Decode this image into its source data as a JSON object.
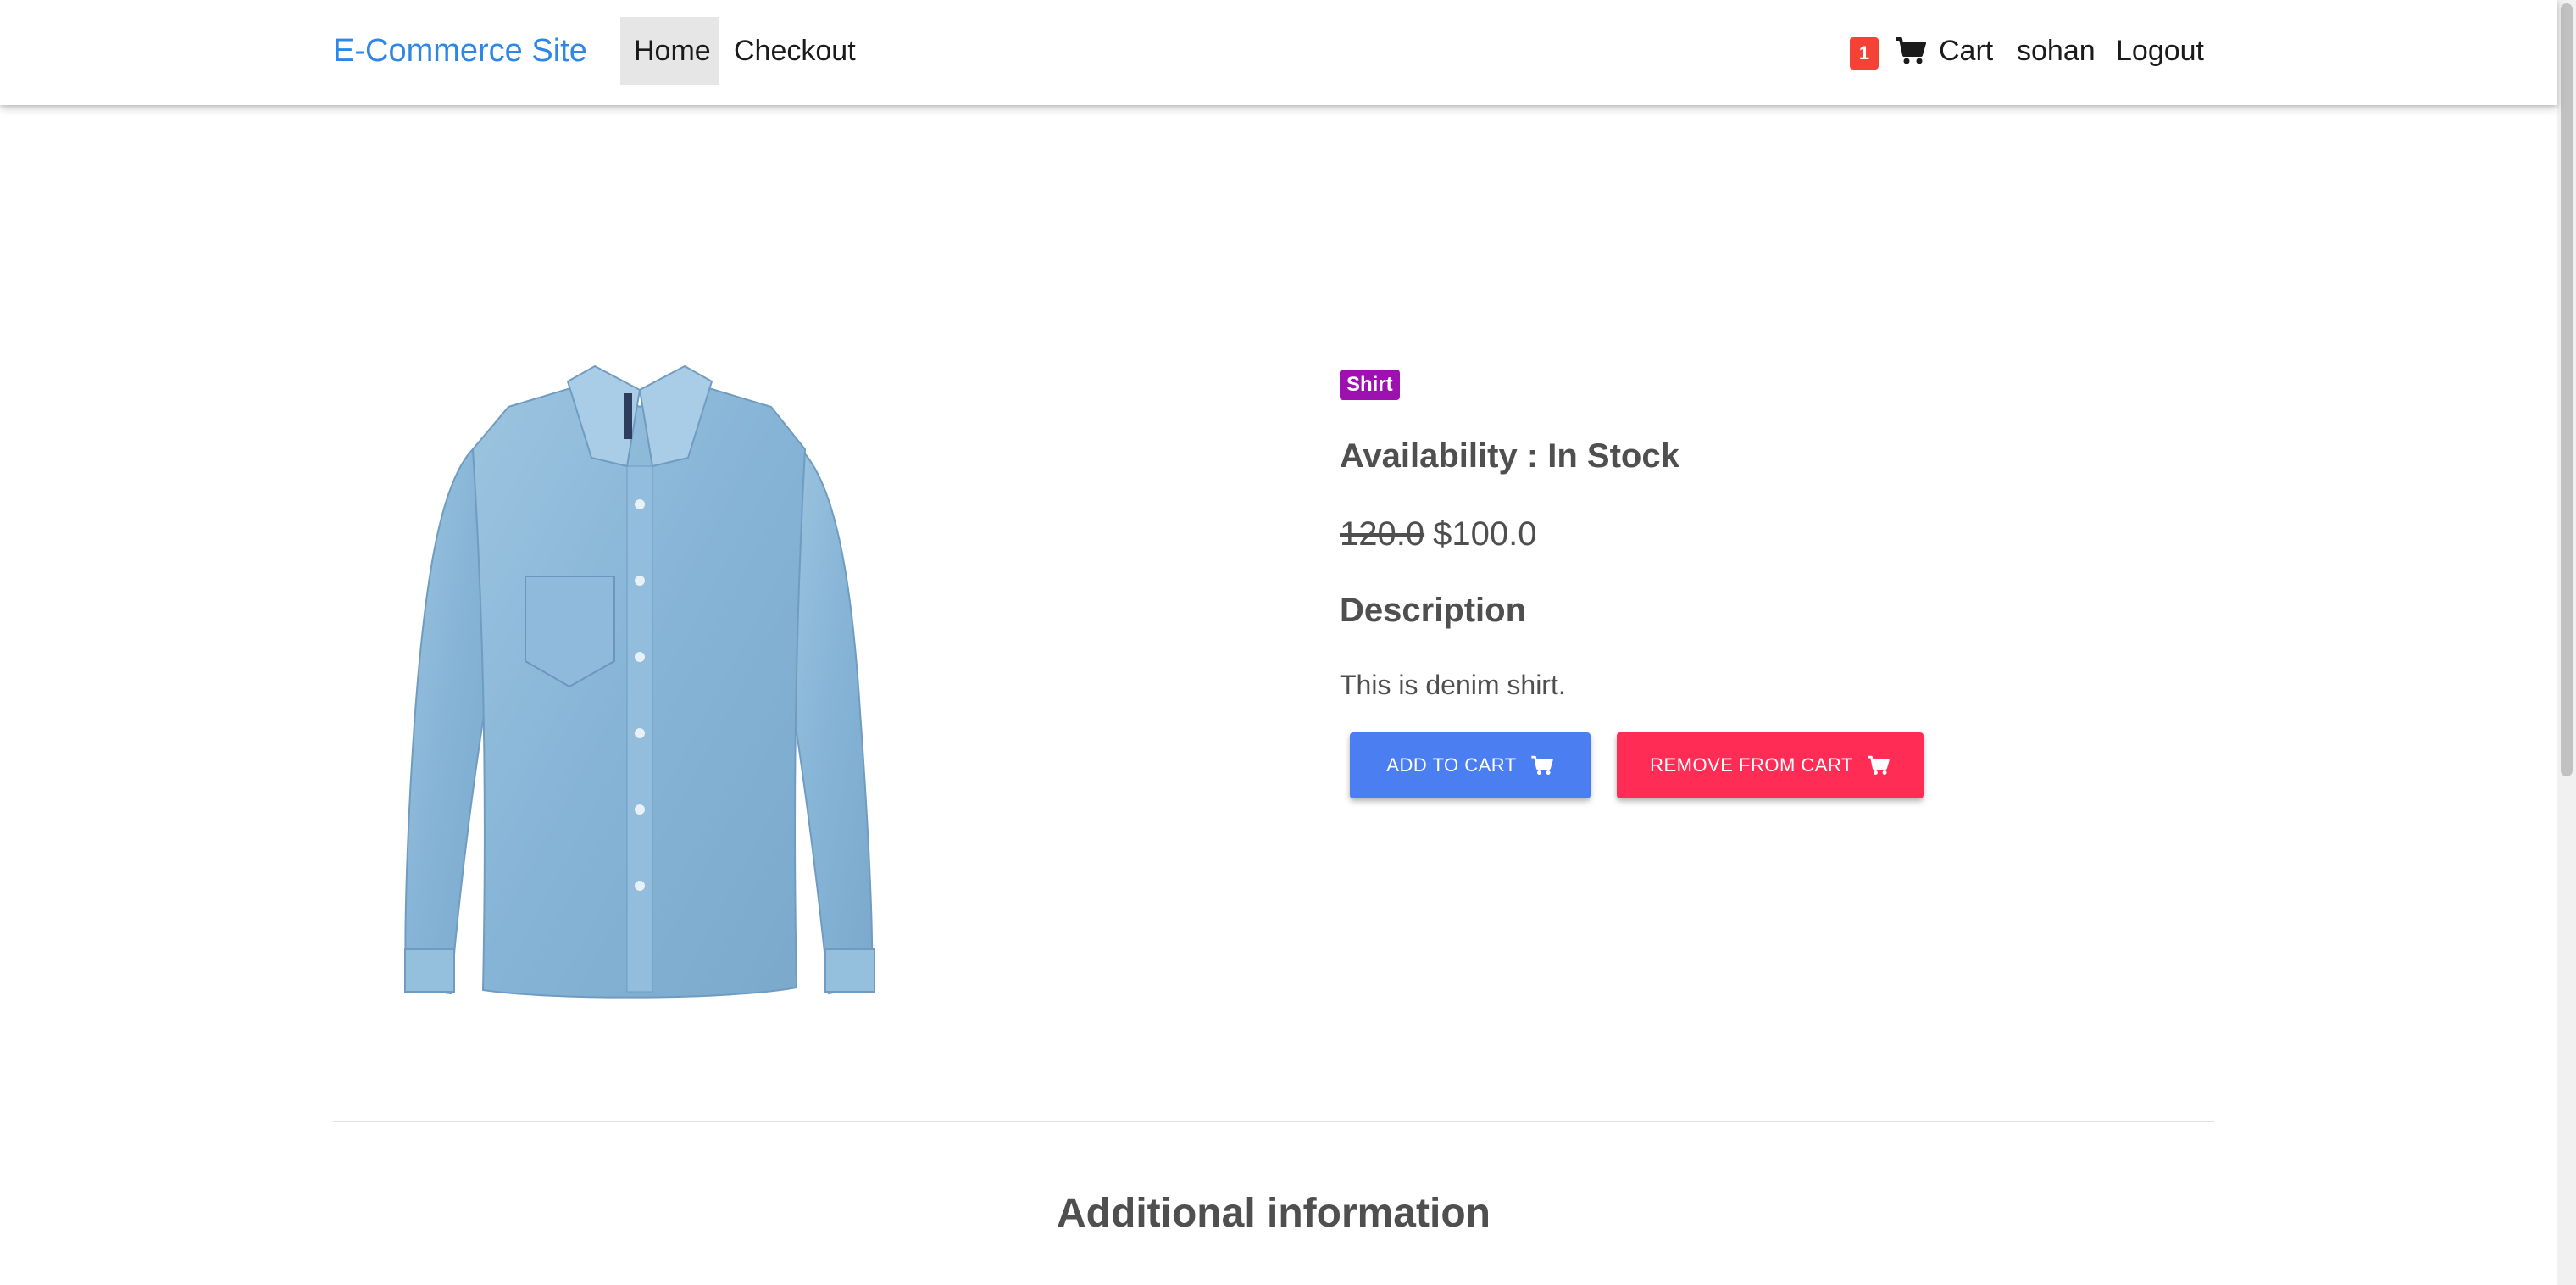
{
  "navbar": {
    "brand": "E-Commerce Site",
    "links": [
      {
        "label": "Home",
        "active": true
      },
      {
        "label": "Checkout",
        "active": false
      }
    ],
    "cart": {
      "count": "1",
      "label": "Cart",
      "icon": "shopping-cart-icon"
    },
    "user": "sohan",
    "logout": "Logout"
  },
  "product": {
    "image_alt": "denim shirt",
    "category": "Shirt",
    "availability": "Availability : In Stock",
    "old_price": "120.0",
    "price": "$100.0",
    "description_heading": "Description",
    "description": "This is denim shirt."
  },
  "actions": {
    "add_to_cart": "ADD TO CART",
    "remove_from_cart": "REMOVE FROM CART",
    "icon": "shopping-cart-icon"
  },
  "sections": {
    "additional_info": "Additional information"
  },
  "colors": {
    "brand": "#2e87e6",
    "badge_red": "#f44336",
    "category_purple": "#9c11b0",
    "add_button": "#4b7ef0",
    "remove_button": "#ff2d55",
    "denim": "#8dbad9"
  }
}
